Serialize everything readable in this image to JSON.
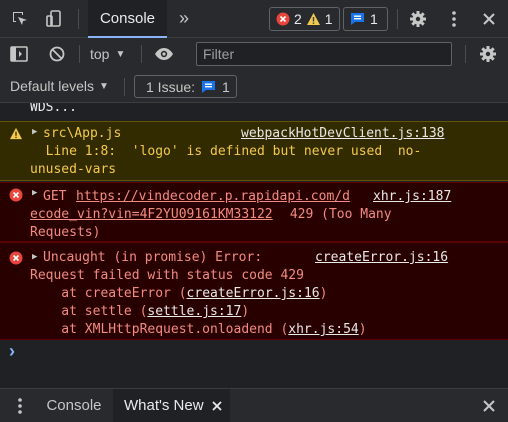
{
  "toolbar": {
    "tab_console": "Console",
    "more_tabs": "»",
    "error_count": "2",
    "warning_count": "1",
    "issue_count": "1"
  },
  "filterbar": {
    "context": "top",
    "filter_placeholder": "Filter"
  },
  "levelsbar": {
    "default_levels": "Default levels",
    "issues_label": "1 Issue:",
    "issues_count": "1"
  },
  "console": {
    "partial_line": "WDS...",
    "warning": {
      "source": "src\\App.js",
      "link": "webpackHotDevClient.js:138",
      "line2": "  Line 1:8:  'logo' is defined but never used  no-",
      "line3": "unused-vars"
    },
    "error1": {
      "method": "GET",
      "url_part1": "https://vindecoder.p.rapidapi.com/d",
      "link": "xhr.js:187",
      "url_part2": "ecode_vin?vin=4F2YU09161KM33122",
      "status_part1": " 429 (Too Many",
      "status_part2": "Requests)"
    },
    "error2": {
      "head": "Uncaught (in promise) Error:",
      "link": "createError.js:16",
      "line2": "Request failed with status code 429",
      "stack1_fn": "    at createError (",
      "stack1_link": "createError.js:16",
      "stack2_fn": "    at settle (",
      "stack2_link": "settle.js:17",
      "stack3_fn": "    at XMLHttpRequest.onloadend (",
      "stack3_link": "xhr.js:54",
      "close_paren": ")"
    },
    "prompt": "›"
  },
  "drawer": {
    "tab_console": "Console",
    "tab_whats_new": "What's New"
  },
  "colors": {
    "error_red": "#e8453c",
    "warning_yellow": "#f2c94c",
    "issue_blue": "#1a73e8",
    "accent_blue": "#8ab4f8"
  }
}
